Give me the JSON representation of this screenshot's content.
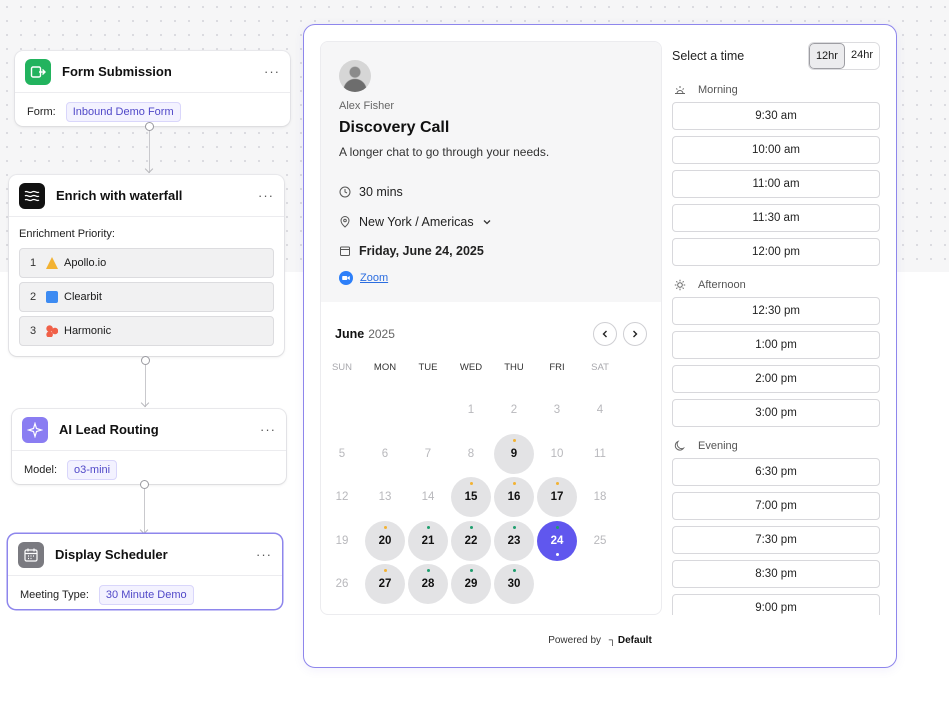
{
  "workflow": {
    "form_node": {
      "title": "Form Submission",
      "field_label": "Form:",
      "field_value": "Inbound Demo Form",
      "more": "···"
    },
    "enrich_node": {
      "title": "Enrich with waterfall",
      "more": "···",
      "priority_label": "Enrichment Priority:",
      "items": [
        {
          "num": "1",
          "name": "Apollo.io",
          "color": "#f2b233"
        },
        {
          "num": "2",
          "name": "Clearbit",
          "color": "#3d8bf2"
        },
        {
          "num": "3",
          "name": "Harmonic",
          "color": "#f06048"
        }
      ]
    },
    "routing_node": {
      "title": "AI Lead Routing",
      "field_label": "Model:",
      "field_value": "o3-mini",
      "more": "···"
    },
    "scheduler_node": {
      "title": "Display Scheduler",
      "field_label": "Meeting Type:",
      "field_value": "30 Minute Demo",
      "more": "···"
    }
  },
  "scheduler": {
    "host": "Alex Fisher",
    "title": "Discovery Call",
    "description": "A longer chat to go through your needs.",
    "duration": "30 mins",
    "timezone": "New York / Americas",
    "date": "Friday, June 24, 2025",
    "location": "Zoom",
    "calendar": {
      "month": "June",
      "year": "2025",
      "weekdays": [
        "SUN",
        "MON",
        "TUE",
        "WED",
        "THU",
        "FRI",
        "SAT"
      ],
      "rows": [
        [
          null,
          null,
          null,
          {
            "d": "1"
          },
          {
            "d": "2"
          },
          {
            "d": "3"
          },
          {
            "d": "4"
          }
        ],
        [
          {
            "d": "5"
          },
          {
            "d": "6"
          },
          {
            "d": "7"
          },
          {
            "d": "8"
          },
          {
            "d": "9",
            "s": "av",
            "dot": "#f2b233"
          },
          {
            "d": "10"
          },
          {
            "d": "11"
          }
        ],
        [
          {
            "d": "12"
          },
          {
            "d": "13"
          },
          {
            "d": "14"
          },
          {
            "d": "15",
            "s": "av",
            "dot": "#f2b233"
          },
          {
            "d": "16",
            "s": "av",
            "dot": "#f2b233"
          },
          {
            "d": "17",
            "s": "av",
            "dot": "#f2b233"
          },
          {
            "d": "18"
          }
        ],
        [
          {
            "d": "19"
          },
          {
            "d": "20",
            "s": "av",
            "dot": "#f2b233"
          },
          {
            "d": "21",
            "s": "av",
            "dot": "#1f9e6e"
          },
          {
            "d": "22",
            "s": "av",
            "dot": "#1f9e6e"
          },
          {
            "d": "23",
            "s": "av",
            "dot": "#1f9e6e"
          },
          {
            "d": "24",
            "s": "sel",
            "dot": "#1f9e6e"
          },
          {
            "d": "25"
          }
        ],
        [
          {
            "d": "26"
          },
          {
            "d": "27",
            "s": "av",
            "dot": "#f2b233"
          },
          {
            "d": "28",
            "s": "av",
            "dot": "#1f9e6e"
          },
          {
            "d": "29",
            "s": "av",
            "dot": "#1f9e6e"
          },
          {
            "d": "30",
            "s": "av",
            "dot": "#1f9e6e"
          },
          null,
          null
        ]
      ]
    },
    "times_title": "Select a time",
    "format_12": "12hr",
    "format_24": "24hr",
    "periods": [
      {
        "label": "Morning",
        "icon": "sunrise-icon",
        "slots": [
          "9:30 am",
          "10:00 am",
          "11:00 am",
          "11:30 am",
          "12:00 pm"
        ]
      },
      {
        "label": "Afternoon",
        "icon": "sun-icon",
        "slots": [
          "12:30 pm",
          "1:00 pm",
          "2:00 pm",
          "3:00 pm"
        ]
      },
      {
        "label": "Evening",
        "icon": "moon-icon",
        "slots": [
          "6:30 pm",
          "7:00 pm",
          "7:30 pm",
          "8:30 pm",
          "9:00 pm"
        ]
      }
    ],
    "powered_prefix": "Powered by",
    "powered_brand": "Default"
  },
  "colors": {
    "accent": "#6057ee",
    "border_accent": "#8e86ec"
  }
}
